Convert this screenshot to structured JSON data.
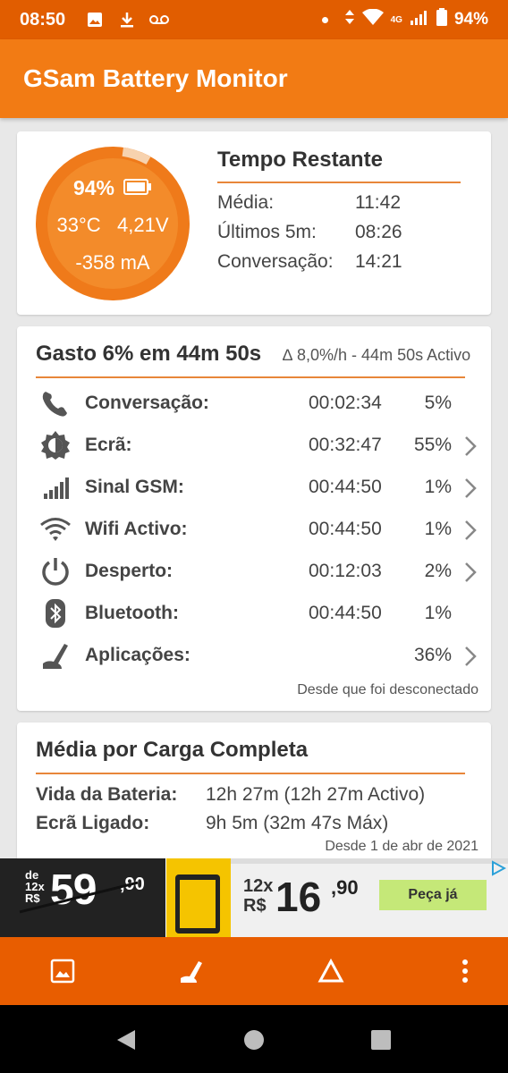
{
  "status_bar": {
    "time": "08:50",
    "left_icons": [
      "image-icon",
      "download-icon",
      "voicemail-icon"
    ],
    "network": "4G",
    "battery": "94%"
  },
  "app": {
    "title": "GSam Battery Monitor"
  },
  "gauge": {
    "percent_text": "94%",
    "level": 0.94,
    "temp": "33°C",
    "voltage": "4,21V",
    "current": "-358 mA",
    "ring_color": "#ef7a1a",
    "fill_color": "#f38b2a"
  },
  "time_remaining": {
    "title": "Tempo Restante",
    "rows": [
      {
        "label": "Média:",
        "value": "11:42"
      },
      {
        "label": "Últimos 5m:",
        "value": "08:26"
      },
      {
        "label": "Conversação:",
        "value": "14:21"
      }
    ]
  },
  "usage": {
    "title": "Gasto 6% em 44m 50s",
    "subtitle": "∆ 8,0%/h - 44m 50s Activo",
    "rows": [
      {
        "icon": "phone-icon",
        "label": "Conversação:",
        "time": "00:02:34",
        "percent": "5%",
        "chevron": false
      },
      {
        "icon": "brightness-icon",
        "label": "Ecrã:",
        "time": "00:32:47",
        "percent": "55%",
        "chevron": true
      },
      {
        "icon": "signal-icon",
        "label": "Sinal GSM:",
        "time": "00:44:50",
        "percent": "1%",
        "chevron": true
      },
      {
        "icon": "wifi-icon",
        "label": "Wifi Activo:",
        "time": "00:44:50",
        "percent": "1%",
        "chevron": true
      },
      {
        "icon": "power-icon",
        "label": "Desperto:",
        "time": "00:12:03",
        "percent": "2%",
        "chevron": true
      },
      {
        "icon": "bluetooth-icon",
        "label": "Bluetooth:",
        "time": "00:44:50",
        "percent": "1%",
        "chevron": false
      },
      {
        "icon": "gauge-app-icon",
        "label": "Aplicações:",
        "time": "",
        "percent": "36%",
        "chevron": true
      }
    ],
    "footer": "Desde que foi desconectado"
  },
  "full_charge": {
    "title": "Média por Carga Completa",
    "rows": [
      {
        "label": "Vida da Bateria:",
        "value": "12h 27m (12h 27m Activo)"
      },
      {
        "label": "Ecrã Ligado:",
        "value": "9h 5m (32m 47s Máx)"
      }
    ],
    "footer": "Desde 1 de abr de 2021"
  },
  "ad": {
    "old_prefix_1": "de",
    "old_prefix_2": "12x",
    "old_prefix_3": "R$",
    "old_price": "59",
    "old_cents": ",90",
    "installments": "12x",
    "currency": "R$",
    "price": "16",
    "cents": ",90",
    "cta": "Peça já"
  },
  "toolbar": {
    "items": [
      "image-icon",
      "gauge-icon",
      "delta-icon",
      "more-vert-icon"
    ]
  },
  "nav": {
    "items": [
      "back-icon",
      "home-icon",
      "recents-icon"
    ]
  }
}
